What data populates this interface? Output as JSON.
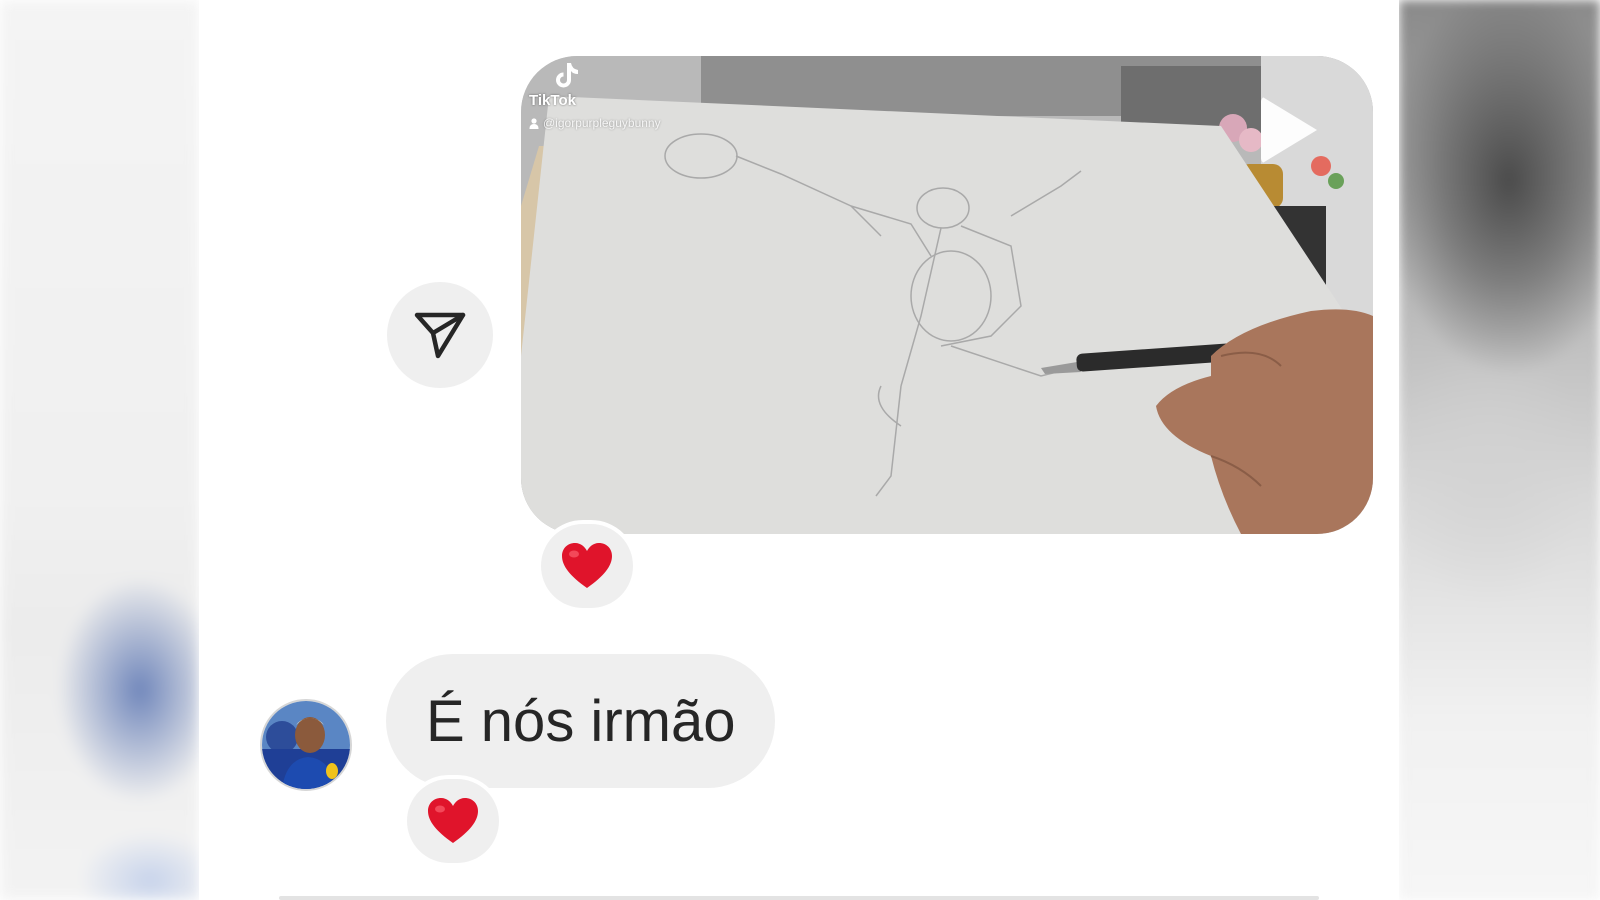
{
  "video_message": {
    "brand": "TikTok",
    "handle": "@igorpurpleguybunny",
    "play_icon": "play-icon",
    "share_icon": "paper-plane-icon"
  },
  "reactions": {
    "video": "❤️",
    "message": "❤️"
  },
  "message": {
    "text": "É nós irmão"
  },
  "colors": {
    "bubble": "#efefef",
    "heart": "#e0142b",
    "text": "#262626"
  }
}
